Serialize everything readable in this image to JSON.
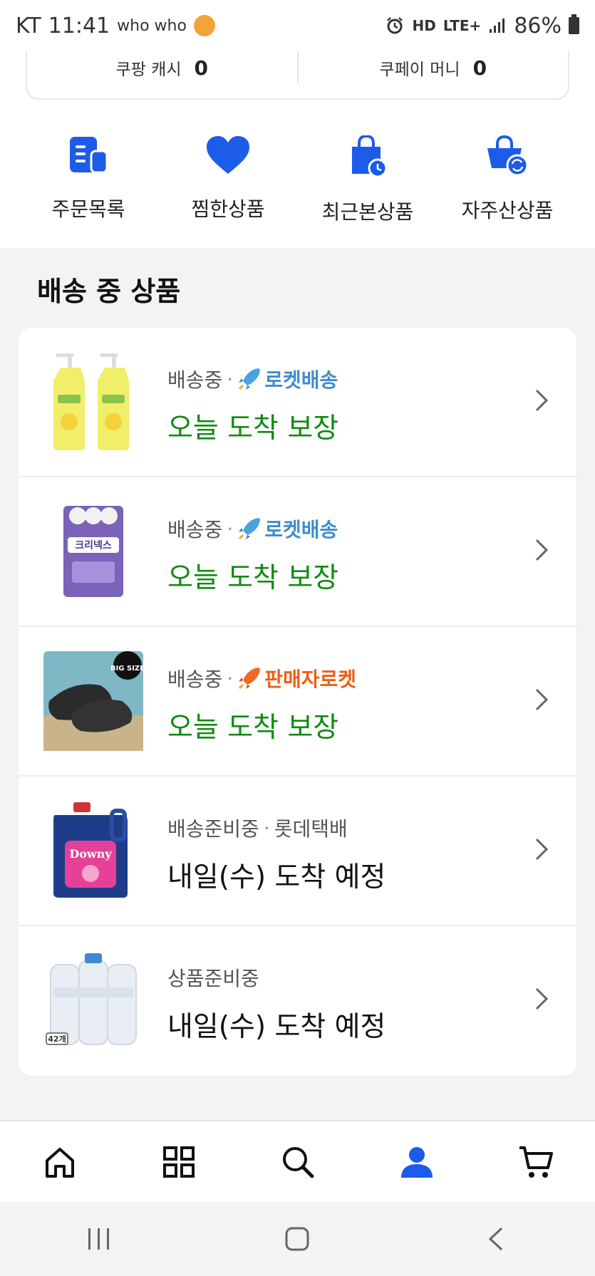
{
  "status_bar": {
    "carrier": "KT",
    "time": "11:41",
    "whowho": "who who",
    "network": "LTE+",
    "hd_label": "HD",
    "battery": "86%"
  },
  "balance": [
    {
      "label": "쿠팡 캐시",
      "value": "0"
    },
    {
      "label": "쿠페이 머니",
      "value": "0"
    }
  ],
  "shortcuts": [
    {
      "label": "주문목록",
      "icon": "order-list-icon"
    },
    {
      "label": "찜한상품",
      "icon": "heart-icon"
    },
    {
      "label": "최근본상품",
      "icon": "recent-bag-icon"
    },
    {
      "label": "자주산상품",
      "icon": "repeat-basket-icon"
    }
  ],
  "section_title": "배송 중 상품",
  "shipping_items": [
    {
      "status": "배송중",
      "badge": "로켓배송",
      "badge_type": "rocket-blue",
      "eta": "오늘 도착 보장",
      "eta_style": "green",
      "product": "dish-soap"
    },
    {
      "status": "배송중",
      "badge": "로켓배송",
      "badge_type": "rocket-blue",
      "eta": "오늘 도착 보장",
      "eta_style": "green",
      "product": "toilet-paper",
      "product_text": "크리넥스"
    },
    {
      "status": "배송중",
      "badge": "판매자로켓",
      "badge_type": "rocket-orange",
      "eta": "오늘 도착 보장",
      "eta_style": "green",
      "product": "slippers",
      "product_text": "BIG SIZE"
    },
    {
      "status": "배송준비중",
      "badge": "롯데택배",
      "badge_type": "plain",
      "eta": "내일(수) 도착 예정",
      "eta_style": "black",
      "product": "fabric-softener",
      "product_text": "Downy"
    },
    {
      "status": "상품준비중",
      "badge": "",
      "badge_type": "none",
      "eta": "내일(수) 도착 예정",
      "eta_style": "black",
      "product": "water-bottles",
      "product_text": "42개"
    }
  ],
  "bottom_nav": [
    {
      "name": "home-icon",
      "active": false
    },
    {
      "name": "category-icon",
      "active": false
    },
    {
      "name": "search-icon",
      "active": false
    },
    {
      "name": "my-coupang-icon",
      "active": true
    },
    {
      "name": "cart-icon",
      "active": false
    }
  ],
  "colors": {
    "accent_blue": "#1d5ce8",
    "eta_green": "#118a12",
    "rocket_blue": "#3f8ccd",
    "rocket_orange": "#eb5f17"
  }
}
